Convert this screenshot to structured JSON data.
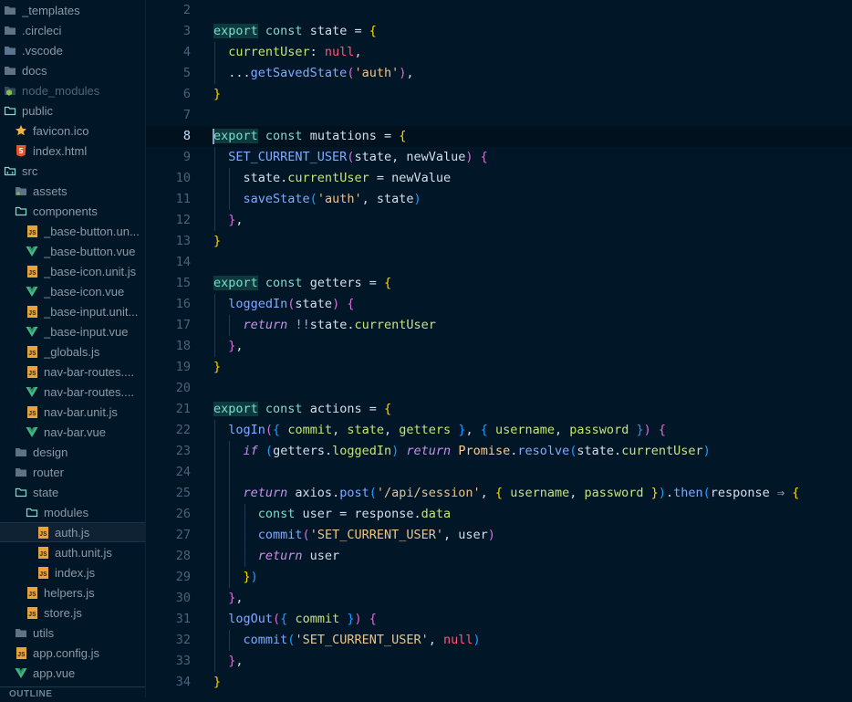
{
  "sidebar": {
    "items": [
      {
        "label": "_templates",
        "icon": "folder-icon",
        "depth": 0
      },
      {
        "label": ".circleci",
        "icon": "folder-icon",
        "depth": 0
      },
      {
        "label": ".vscode",
        "icon": "vscode-folder-icon",
        "depth": 0
      },
      {
        "label": "docs",
        "icon": "folder-icon",
        "depth": 0
      },
      {
        "label": "node_modules",
        "icon": "node-folder-icon",
        "depth": 0,
        "dim": true
      },
      {
        "label": "public",
        "icon": "folder-open-icon",
        "depth": 0
      },
      {
        "label": "favicon.ico",
        "icon": "star-icon",
        "depth": 1
      },
      {
        "label": "index.html",
        "icon": "html5-icon",
        "depth": 1
      },
      {
        "label": "src",
        "icon": "src-folder-open-icon",
        "depth": 0
      },
      {
        "label": "assets",
        "icon": "assets-folder-icon",
        "depth": 1
      },
      {
        "label": "components",
        "icon": "folder-open-icon",
        "depth": 1
      },
      {
        "label": "_base-button.un...",
        "icon": "js-file-icon",
        "depth": 2
      },
      {
        "label": "_base-button.vue",
        "icon": "vue-icon",
        "depth": 2
      },
      {
        "label": "_base-icon.unit.js",
        "icon": "js-file-icon",
        "depth": 2
      },
      {
        "label": "_base-icon.vue",
        "icon": "vue-icon",
        "depth": 2
      },
      {
        "label": "_base-input.unit...",
        "icon": "js-file-icon",
        "depth": 2
      },
      {
        "label": "_base-input.vue",
        "icon": "vue-icon",
        "depth": 2
      },
      {
        "label": "_globals.js",
        "icon": "js-file-icon",
        "depth": 2
      },
      {
        "label": "nav-bar-routes....",
        "icon": "js-file-icon",
        "depth": 2
      },
      {
        "label": "nav-bar-routes....",
        "icon": "vue-icon",
        "depth": 2
      },
      {
        "label": "nav-bar.unit.js",
        "icon": "js-file-icon",
        "depth": 2
      },
      {
        "label": "nav-bar.vue",
        "icon": "vue-icon",
        "depth": 2
      },
      {
        "label": "design",
        "icon": "folder-icon",
        "depth": 1
      },
      {
        "label": "router",
        "icon": "folder-icon",
        "depth": 1
      },
      {
        "label": "state",
        "icon": "folder-open-icon",
        "depth": 1
      },
      {
        "label": "modules",
        "icon": "folder-open-icon",
        "depth": 2
      },
      {
        "label": "auth.js",
        "icon": "js-file-icon",
        "depth": 3,
        "selected": true
      },
      {
        "label": "auth.unit.js",
        "icon": "js-file-icon",
        "depth": 3
      },
      {
        "label": "index.js",
        "icon": "js-file-icon",
        "depth": 3
      },
      {
        "label": "helpers.js",
        "icon": "js-file-icon",
        "depth": 2
      },
      {
        "label": "store.js",
        "icon": "js-file-icon",
        "depth": 2
      },
      {
        "label": "utils",
        "icon": "folder-icon",
        "depth": 1
      },
      {
        "label": "app.config.js",
        "icon": "js-file-icon",
        "depth": 1
      },
      {
        "label": "app.vue",
        "icon": "vue-icon",
        "depth": 1
      }
    ],
    "outline_label": "OUTLINE"
  },
  "editor": {
    "current_line": 8,
    "lines": [
      {
        "n": 2,
        "indent": 0,
        "tokens": []
      },
      {
        "n": 3,
        "indent": 0,
        "tokens": [
          [
            "kw",
            "export"
          ],
          [
            "plain",
            " "
          ],
          [
            "kwp",
            "const"
          ],
          [
            "plain",
            " state = "
          ],
          [
            "b1",
            "{"
          ]
        ]
      },
      {
        "n": 4,
        "indent": 1,
        "tokens": [
          [
            "prop",
            "currentUser"
          ],
          [
            "plain",
            ": "
          ],
          [
            "null",
            "null"
          ],
          [
            "plain",
            ","
          ]
        ]
      },
      {
        "n": 5,
        "indent": 1,
        "tokens": [
          [
            "plain",
            "..."
          ],
          [
            "fn",
            "getSavedState"
          ],
          [
            "b2",
            "("
          ],
          [
            "str",
            "'auth'"
          ],
          [
            "b2",
            ")"
          ],
          [
            "plain",
            ","
          ]
        ]
      },
      {
        "n": 6,
        "indent": 0,
        "tokens": [
          [
            "b1",
            "}"
          ]
        ]
      },
      {
        "n": 7,
        "indent": 0,
        "tokens": []
      },
      {
        "n": 8,
        "indent": 0,
        "tokens": [
          [
            "kw",
            "export"
          ],
          [
            "plain",
            " "
          ],
          [
            "kwp",
            "const"
          ],
          [
            "plain",
            " mutations = "
          ],
          [
            "b1",
            "{"
          ]
        ]
      },
      {
        "n": 9,
        "indent": 1,
        "tokens": [
          [
            "fn",
            "SET_CURRENT_USER"
          ],
          [
            "b2",
            "("
          ],
          [
            "plain",
            "state, newValue"
          ],
          [
            "b2",
            ")"
          ],
          [
            "plain",
            " "
          ],
          [
            "b2",
            "{"
          ]
        ]
      },
      {
        "n": 10,
        "indent": 2,
        "tokens": [
          [
            "plain",
            "state"
          ],
          [
            "plain",
            "."
          ],
          [
            "prop",
            "currentUser"
          ],
          [
            "plain",
            " = newValue"
          ]
        ]
      },
      {
        "n": 11,
        "indent": 2,
        "tokens": [
          [
            "fn",
            "saveState"
          ],
          [
            "b3",
            "("
          ],
          [
            "str",
            "'auth'"
          ],
          [
            "plain",
            ", state"
          ],
          [
            "b3",
            ")"
          ]
        ]
      },
      {
        "n": 12,
        "indent": 1,
        "tokens": [
          [
            "b2",
            "}"
          ],
          [
            "plain",
            ","
          ]
        ]
      },
      {
        "n": 13,
        "indent": 0,
        "tokens": [
          [
            "b1",
            "}"
          ]
        ]
      },
      {
        "n": 14,
        "indent": 0,
        "tokens": []
      },
      {
        "n": 15,
        "indent": 0,
        "tokens": [
          [
            "kw",
            "export"
          ],
          [
            "plain",
            " "
          ],
          [
            "kwp",
            "const"
          ],
          [
            "plain",
            " getters = "
          ],
          [
            "b1",
            "{"
          ]
        ]
      },
      {
        "n": 16,
        "indent": 1,
        "tokens": [
          [
            "fn",
            "loggedIn"
          ],
          [
            "b2",
            "("
          ],
          [
            "plain",
            "state"
          ],
          [
            "b2",
            ")"
          ],
          [
            "plain",
            " "
          ],
          [
            "b2",
            "{"
          ]
        ]
      },
      {
        "n": 17,
        "indent": 2,
        "tokens": [
          [
            "ret",
            "return"
          ],
          [
            "plain",
            " "
          ],
          [
            "op",
            "!!"
          ],
          [
            "plain",
            "state."
          ],
          [
            "prop",
            "currentUser"
          ]
        ]
      },
      {
        "n": 18,
        "indent": 1,
        "tokens": [
          [
            "b2",
            "}"
          ],
          [
            "plain",
            ","
          ]
        ]
      },
      {
        "n": 19,
        "indent": 0,
        "tokens": [
          [
            "b1",
            "}"
          ]
        ]
      },
      {
        "n": 20,
        "indent": 0,
        "tokens": []
      },
      {
        "n": 21,
        "indent": 0,
        "tokens": [
          [
            "kw",
            "export"
          ],
          [
            "plain",
            " "
          ],
          [
            "kwp",
            "const"
          ],
          [
            "plain",
            " actions = "
          ],
          [
            "b1",
            "{"
          ]
        ]
      },
      {
        "n": 22,
        "indent": 1,
        "tokens": [
          [
            "fn",
            "logIn"
          ],
          [
            "b2",
            "("
          ],
          [
            "b3",
            "{"
          ],
          [
            "plain",
            " "
          ],
          [
            "prop",
            "commit"
          ],
          [
            "plain",
            ", "
          ],
          [
            "prop",
            "state"
          ],
          [
            "plain",
            ", "
          ],
          [
            "prop",
            "getters"
          ],
          [
            "plain",
            " "
          ],
          [
            "b3",
            "}"
          ],
          [
            "plain",
            ", "
          ],
          [
            "b3",
            "{"
          ],
          [
            "plain",
            " "
          ],
          [
            "prop",
            "username"
          ],
          [
            "plain",
            ", "
          ],
          [
            "prop",
            "password"
          ],
          [
            "plain",
            " "
          ],
          [
            "b3",
            "}"
          ],
          [
            "b2",
            ")"
          ],
          [
            "plain",
            " "
          ],
          [
            "b2",
            "{"
          ]
        ]
      },
      {
        "n": 23,
        "indent": 2,
        "tokens": [
          [
            "ret",
            "if"
          ],
          [
            "plain",
            " "
          ],
          [
            "b3",
            "("
          ],
          [
            "plain",
            "getters."
          ],
          [
            "prop",
            "loggedIn"
          ],
          [
            "b3",
            ")"
          ],
          [
            "plain",
            " "
          ],
          [
            "ret",
            "return"
          ],
          [
            "plain",
            " "
          ],
          [
            "class",
            "Promise"
          ],
          [
            "plain",
            "."
          ],
          [
            "fn",
            "resolve"
          ],
          [
            "b3",
            "("
          ],
          [
            "plain",
            "state."
          ],
          [
            "prop",
            "currentUser"
          ],
          [
            "b3",
            ")"
          ]
        ]
      },
      {
        "n": 24,
        "indent": 2,
        "tokens": []
      },
      {
        "n": 25,
        "indent": 2,
        "tokens": [
          [
            "ret",
            "return"
          ],
          [
            "plain",
            " axios."
          ],
          [
            "fn",
            "post"
          ],
          [
            "b3",
            "("
          ],
          [
            "str",
            "'/api/session'"
          ],
          [
            "plain",
            ", "
          ],
          [
            "b1",
            "{"
          ],
          [
            "plain",
            " "
          ],
          [
            "prop",
            "username"
          ],
          [
            "plain",
            ", "
          ],
          [
            "prop",
            "password"
          ],
          [
            "plain",
            " "
          ],
          [
            "b1",
            "}"
          ],
          [
            "b3",
            ")"
          ],
          [
            "plain",
            "."
          ],
          [
            "fn",
            "then"
          ],
          [
            "b3",
            "("
          ],
          [
            "plain",
            "response "
          ],
          [
            "kwp",
            "⇒"
          ],
          [
            "plain",
            " "
          ],
          [
            "b1",
            "{"
          ]
        ]
      },
      {
        "n": 26,
        "indent": 3,
        "tokens": [
          [
            "kwp",
            "const"
          ],
          [
            "plain",
            " user = response."
          ],
          [
            "prop",
            "data"
          ]
        ]
      },
      {
        "n": 27,
        "indent": 3,
        "tokens": [
          [
            "fn",
            "commit"
          ],
          [
            "b2",
            "("
          ],
          [
            "str",
            "'SET_CURRENT_USER'"
          ],
          [
            "plain",
            ", user"
          ],
          [
            "b2",
            ")"
          ]
        ]
      },
      {
        "n": 28,
        "indent": 3,
        "tokens": [
          [
            "ret",
            "return"
          ],
          [
            "plain",
            " user"
          ]
        ]
      },
      {
        "n": 29,
        "indent": 2,
        "tokens": [
          [
            "b1",
            "}"
          ],
          [
            "b3",
            ")"
          ]
        ]
      },
      {
        "n": 30,
        "indent": 1,
        "tokens": [
          [
            "b2",
            "}"
          ],
          [
            "plain",
            ","
          ]
        ]
      },
      {
        "n": 31,
        "indent": 1,
        "tokens": [
          [
            "fn",
            "logOut"
          ],
          [
            "b2",
            "("
          ],
          [
            "b3",
            "{"
          ],
          [
            "plain",
            " "
          ],
          [
            "prop",
            "commit"
          ],
          [
            "plain",
            " "
          ],
          [
            "b3",
            "}"
          ],
          [
            "b2",
            ")"
          ],
          [
            "plain",
            " "
          ],
          [
            "b2",
            "{"
          ]
        ]
      },
      {
        "n": 32,
        "indent": 2,
        "tokens": [
          [
            "fn",
            "commit"
          ],
          [
            "b3",
            "("
          ],
          [
            "str",
            "'SET_CURRENT_USER'"
          ],
          [
            "plain",
            ", "
          ],
          [
            "null",
            "null"
          ],
          [
            "b3",
            ")"
          ]
        ]
      },
      {
        "n": 33,
        "indent": 1,
        "tokens": [
          [
            "b2",
            "}"
          ],
          [
            "plain",
            ","
          ]
        ]
      },
      {
        "n": 34,
        "indent": 0,
        "tokens": [
          [
            "b1",
            "}"
          ]
        ]
      }
    ]
  },
  "colors": {
    "background": "#011627",
    "keyword": "#7fdbca",
    "function": "#82aaff",
    "string": "#ecc48d",
    "null": "#ff5874",
    "property": "#c5e478",
    "italic_keyword": "#c792ea"
  }
}
